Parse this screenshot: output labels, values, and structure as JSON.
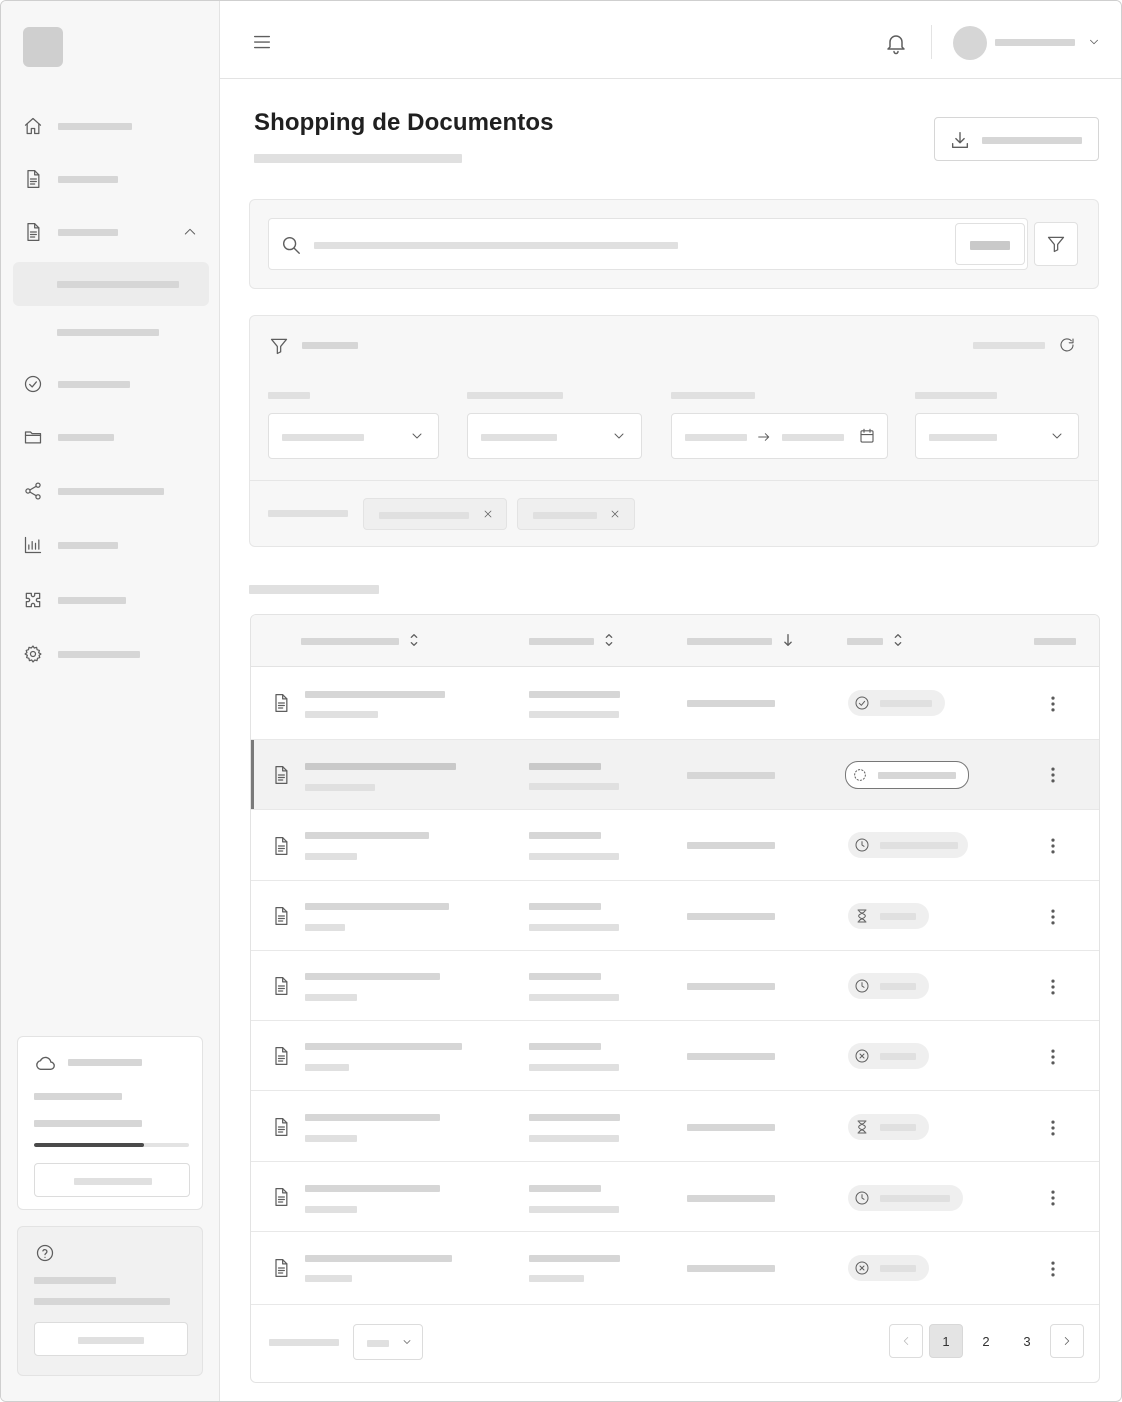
{
  "page": {
    "title": "Shopping de Documentos"
  },
  "pagination": {
    "pages": [
      "1",
      "2",
      "3"
    ],
    "current": "1"
  },
  "storage": {
    "used_fraction": 0.71
  },
  "icons": {
    "menu": "menu-icon",
    "notifications": "bell-icon",
    "user_menu": "chevron-down-icon",
    "export": "download-icon",
    "search": "search-icon",
    "filter": "filter-icon",
    "refresh": "refresh-icon",
    "calendar": "calendar-icon",
    "sidebar": [
      "home-icon",
      "document-icon",
      "document-icon",
      "check-circle-icon",
      "folder-icon",
      "share-icon",
      "bar-chart-icon",
      "puzzle-icon",
      "gear-icon"
    ],
    "storage": "cloud-icon",
    "help": "help-circle-icon",
    "row_status": [
      "check-circle-icon",
      "spinner-icon",
      "clock-icon",
      "hourglass-icon",
      "clock-icon",
      "x-circle-icon",
      "hourglass-icon",
      "clock-icon",
      "x-circle-icon"
    ]
  },
  "colors": {
    "placeholder": "#d6d6d6",
    "sidebar_bg": "#f7f7f7",
    "selected_row_bg": "#f2f2f2",
    "progress_fill": "#4a4a4a"
  }
}
